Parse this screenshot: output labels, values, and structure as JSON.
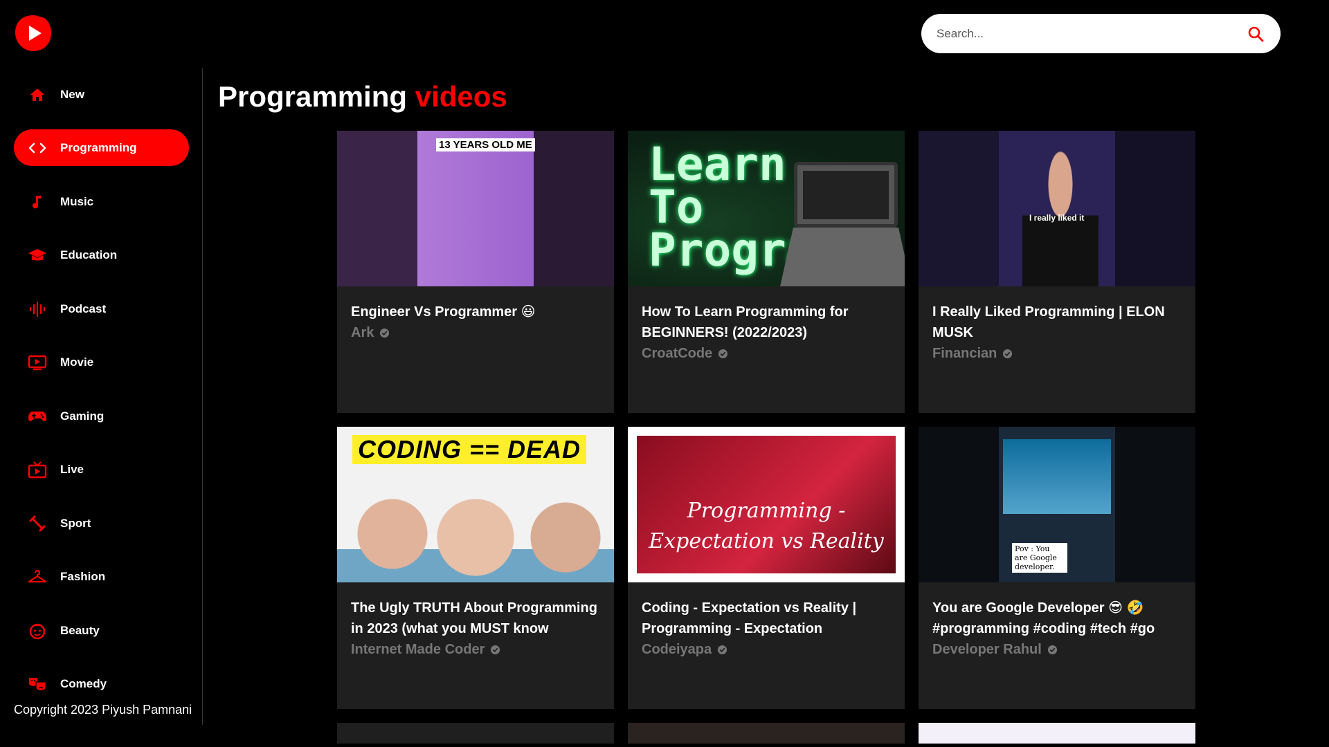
{
  "brand": {
    "accent": "#ff0000",
    "logo_icon": "play-logo-icon"
  },
  "search": {
    "placeholder": "Search..."
  },
  "sidebar": {
    "items": [
      {
        "label": "New",
        "icon": "home-icon",
        "active": false
      },
      {
        "label": "Programming",
        "icon": "code-icon",
        "active": true
      },
      {
        "label": "Music",
        "icon": "music-note-icon",
        "active": false
      },
      {
        "label": "Education",
        "icon": "graduation-cap-icon",
        "active": false
      },
      {
        "label": "Podcast",
        "icon": "podcast-icon",
        "active": false
      },
      {
        "label": "Movie",
        "icon": "movie-icon",
        "active": false
      },
      {
        "label": "Gaming",
        "icon": "gamepad-icon",
        "active": false
      },
      {
        "label": "Live",
        "icon": "live-tv-icon",
        "active": false
      },
      {
        "label": "Sport",
        "icon": "sport-icon",
        "active": false
      },
      {
        "label": "Fashion",
        "icon": "hanger-icon",
        "active": false
      },
      {
        "label": "Beauty",
        "icon": "beauty-icon",
        "active": false
      },
      {
        "label": "Comedy",
        "icon": "comedy-masks-icon",
        "active": false
      }
    ],
    "copyright": "Copyright 2023 Piyush Pamnani"
  },
  "main": {
    "title_main": "Programming",
    "title_accent": "videos",
    "videos": [
      {
        "title": "Engineer Vs Programmer 😃",
        "channel": "Ark",
        "thumb_text": "13 YEARS OLD ME"
      },
      {
        "title": "How To Learn Programming for BEGINNERS! (2022/2023)",
        "channel": "CroatCode",
        "thumb_text": "Learn To Program"
      },
      {
        "title": "I Really Liked Programming | ELON MUSK",
        "channel": "Financian",
        "thumb_text": "I really liked it"
      },
      {
        "title": "The Ugly TRUTH About Programming in 2023 (what you MUST know",
        "channel": "Internet Made Coder",
        "thumb_text": "CODING == DEAD"
      },
      {
        "title": "Coding - Expectation vs Reality | Programming - Expectation",
        "channel": "Codeiyapa",
        "thumb_text": "Programming - Expectation vs Reality"
      },
      {
        "title": "You are Google Developer 😎 🤣 #programming #coding #tech #go",
        "channel": "Developer Rahul",
        "thumb_text": "Pov : You are Google developer."
      }
    ]
  }
}
